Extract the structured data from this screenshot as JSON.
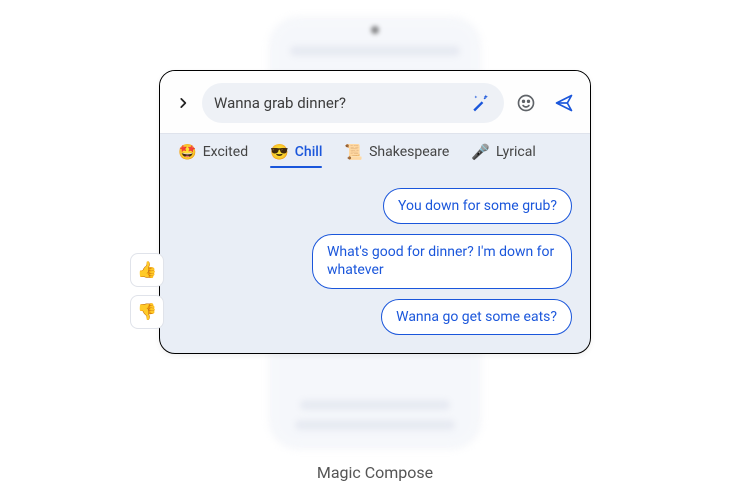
{
  "compose": {
    "input_text": "Wanna grab dinner?"
  },
  "styles": {
    "active_index": 1,
    "items": [
      {
        "emoji": "🤩",
        "label": "Excited"
      },
      {
        "emoji": "😎",
        "label": "Chill"
      },
      {
        "emoji": "📜",
        "label": "Shakespeare"
      },
      {
        "emoji": "🎤",
        "label": "Lyrical"
      }
    ]
  },
  "suggestions": [
    "You down for some grub?",
    "What's good for dinner? I'm down for whatever",
    "Wanna go get some eats?"
  ],
  "caption": "Magic Compose"
}
